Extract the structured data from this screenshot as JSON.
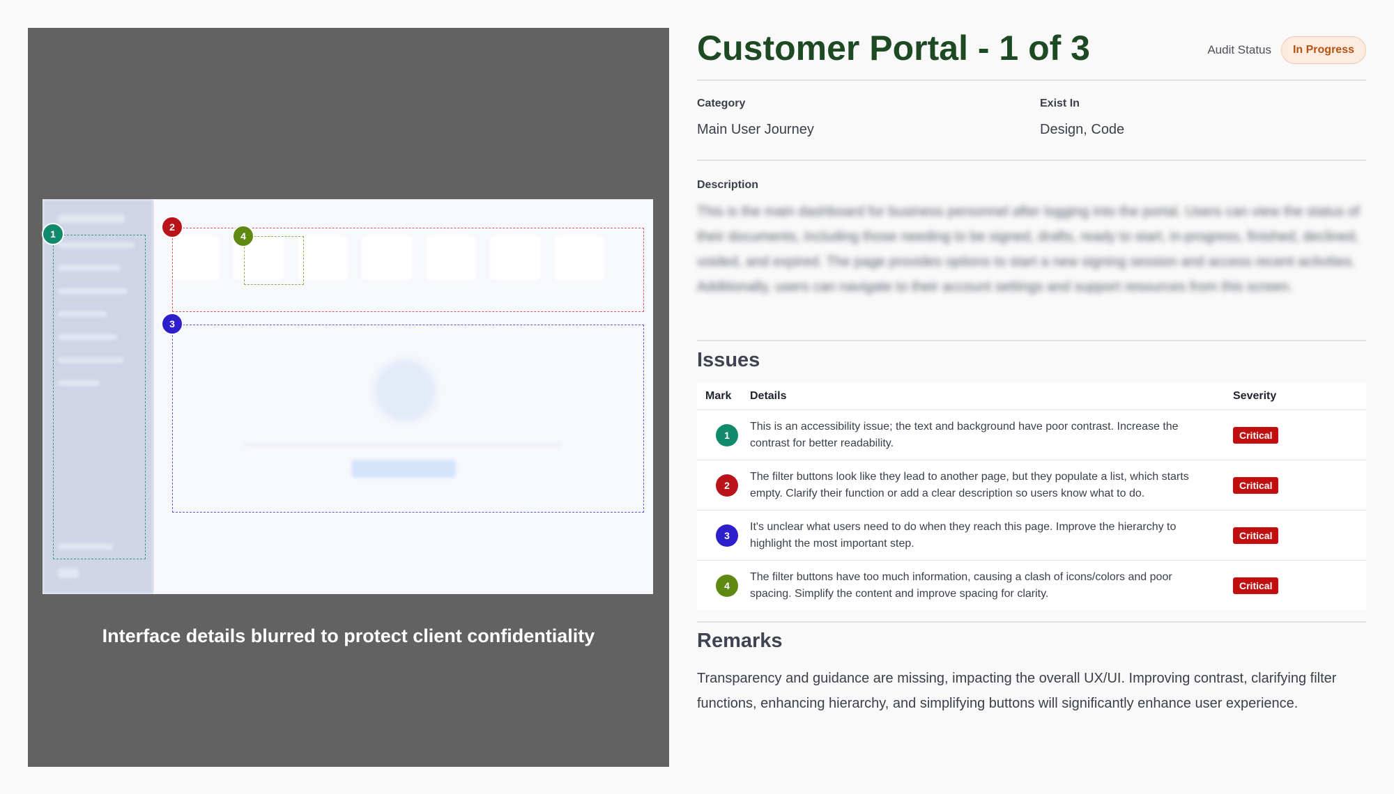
{
  "preview": {
    "caption": "Interface details blurred to protect client confidentiality",
    "marks": [
      {
        "num": "1",
        "color": "#0f8a6a"
      },
      {
        "num": "2",
        "color": "#b8141a"
      },
      {
        "num": "3",
        "color": "#2d1fcc"
      },
      {
        "num": "4",
        "color": "#5e8a12"
      }
    ]
  },
  "header": {
    "title": "Customer Portal - 1 of 3",
    "audit_label": "Audit Status",
    "status": "In Progress"
  },
  "fields": {
    "category_label": "Category",
    "category_value": "Main User Journey",
    "exist_label": "Exist In",
    "exist_value": "Design, Code"
  },
  "description": {
    "label": "Description",
    "text": "This is the main dashboard for business personnel after logging into the portal. Users can view the status of their documents, including those needing to be signed, drafts, ready to start, in-progress, finished, declined, voided, and expired. The page provides options to start a new signing session and access recent activities. Additionally, users can navigate to their account settings and support resources from this screen."
  },
  "issues": {
    "heading": "Issues",
    "columns": {
      "mark": "Mark",
      "details": "Details",
      "severity": "Severity"
    },
    "rows": [
      {
        "mark": "1",
        "color": "#0f8a6a",
        "details": "This is an accessibility issue; the text and background have poor contrast. Increase the contrast for better readability.",
        "severity": "Critical"
      },
      {
        "mark": "2",
        "color": "#b8141a",
        "details": "The filter buttons look like they lead to another page, but they populate a list, which starts empty. Clarify their function or add a clear description so users know what to do.",
        "severity": "Critical"
      },
      {
        "mark": "3",
        "color": "#2d1fcc",
        "details": "It's unclear what users need to do when they reach this page. Improve the hierarchy to highlight the most important step.",
        "severity": "Critical"
      },
      {
        "mark": "4",
        "color": "#5e8a12",
        "details": "The filter buttons have too much information, causing a clash of icons/colors and poor spacing. Simplify the content and improve spacing for clarity.",
        "severity": "Critical"
      }
    ]
  },
  "remarks": {
    "heading": "Remarks",
    "text": "Transparency and guidance are missing, impacting the overall UX/UI. Improving contrast, clarifying filter functions, enhancing hierarchy, and simplifying buttons will significantly enhance user experience."
  }
}
